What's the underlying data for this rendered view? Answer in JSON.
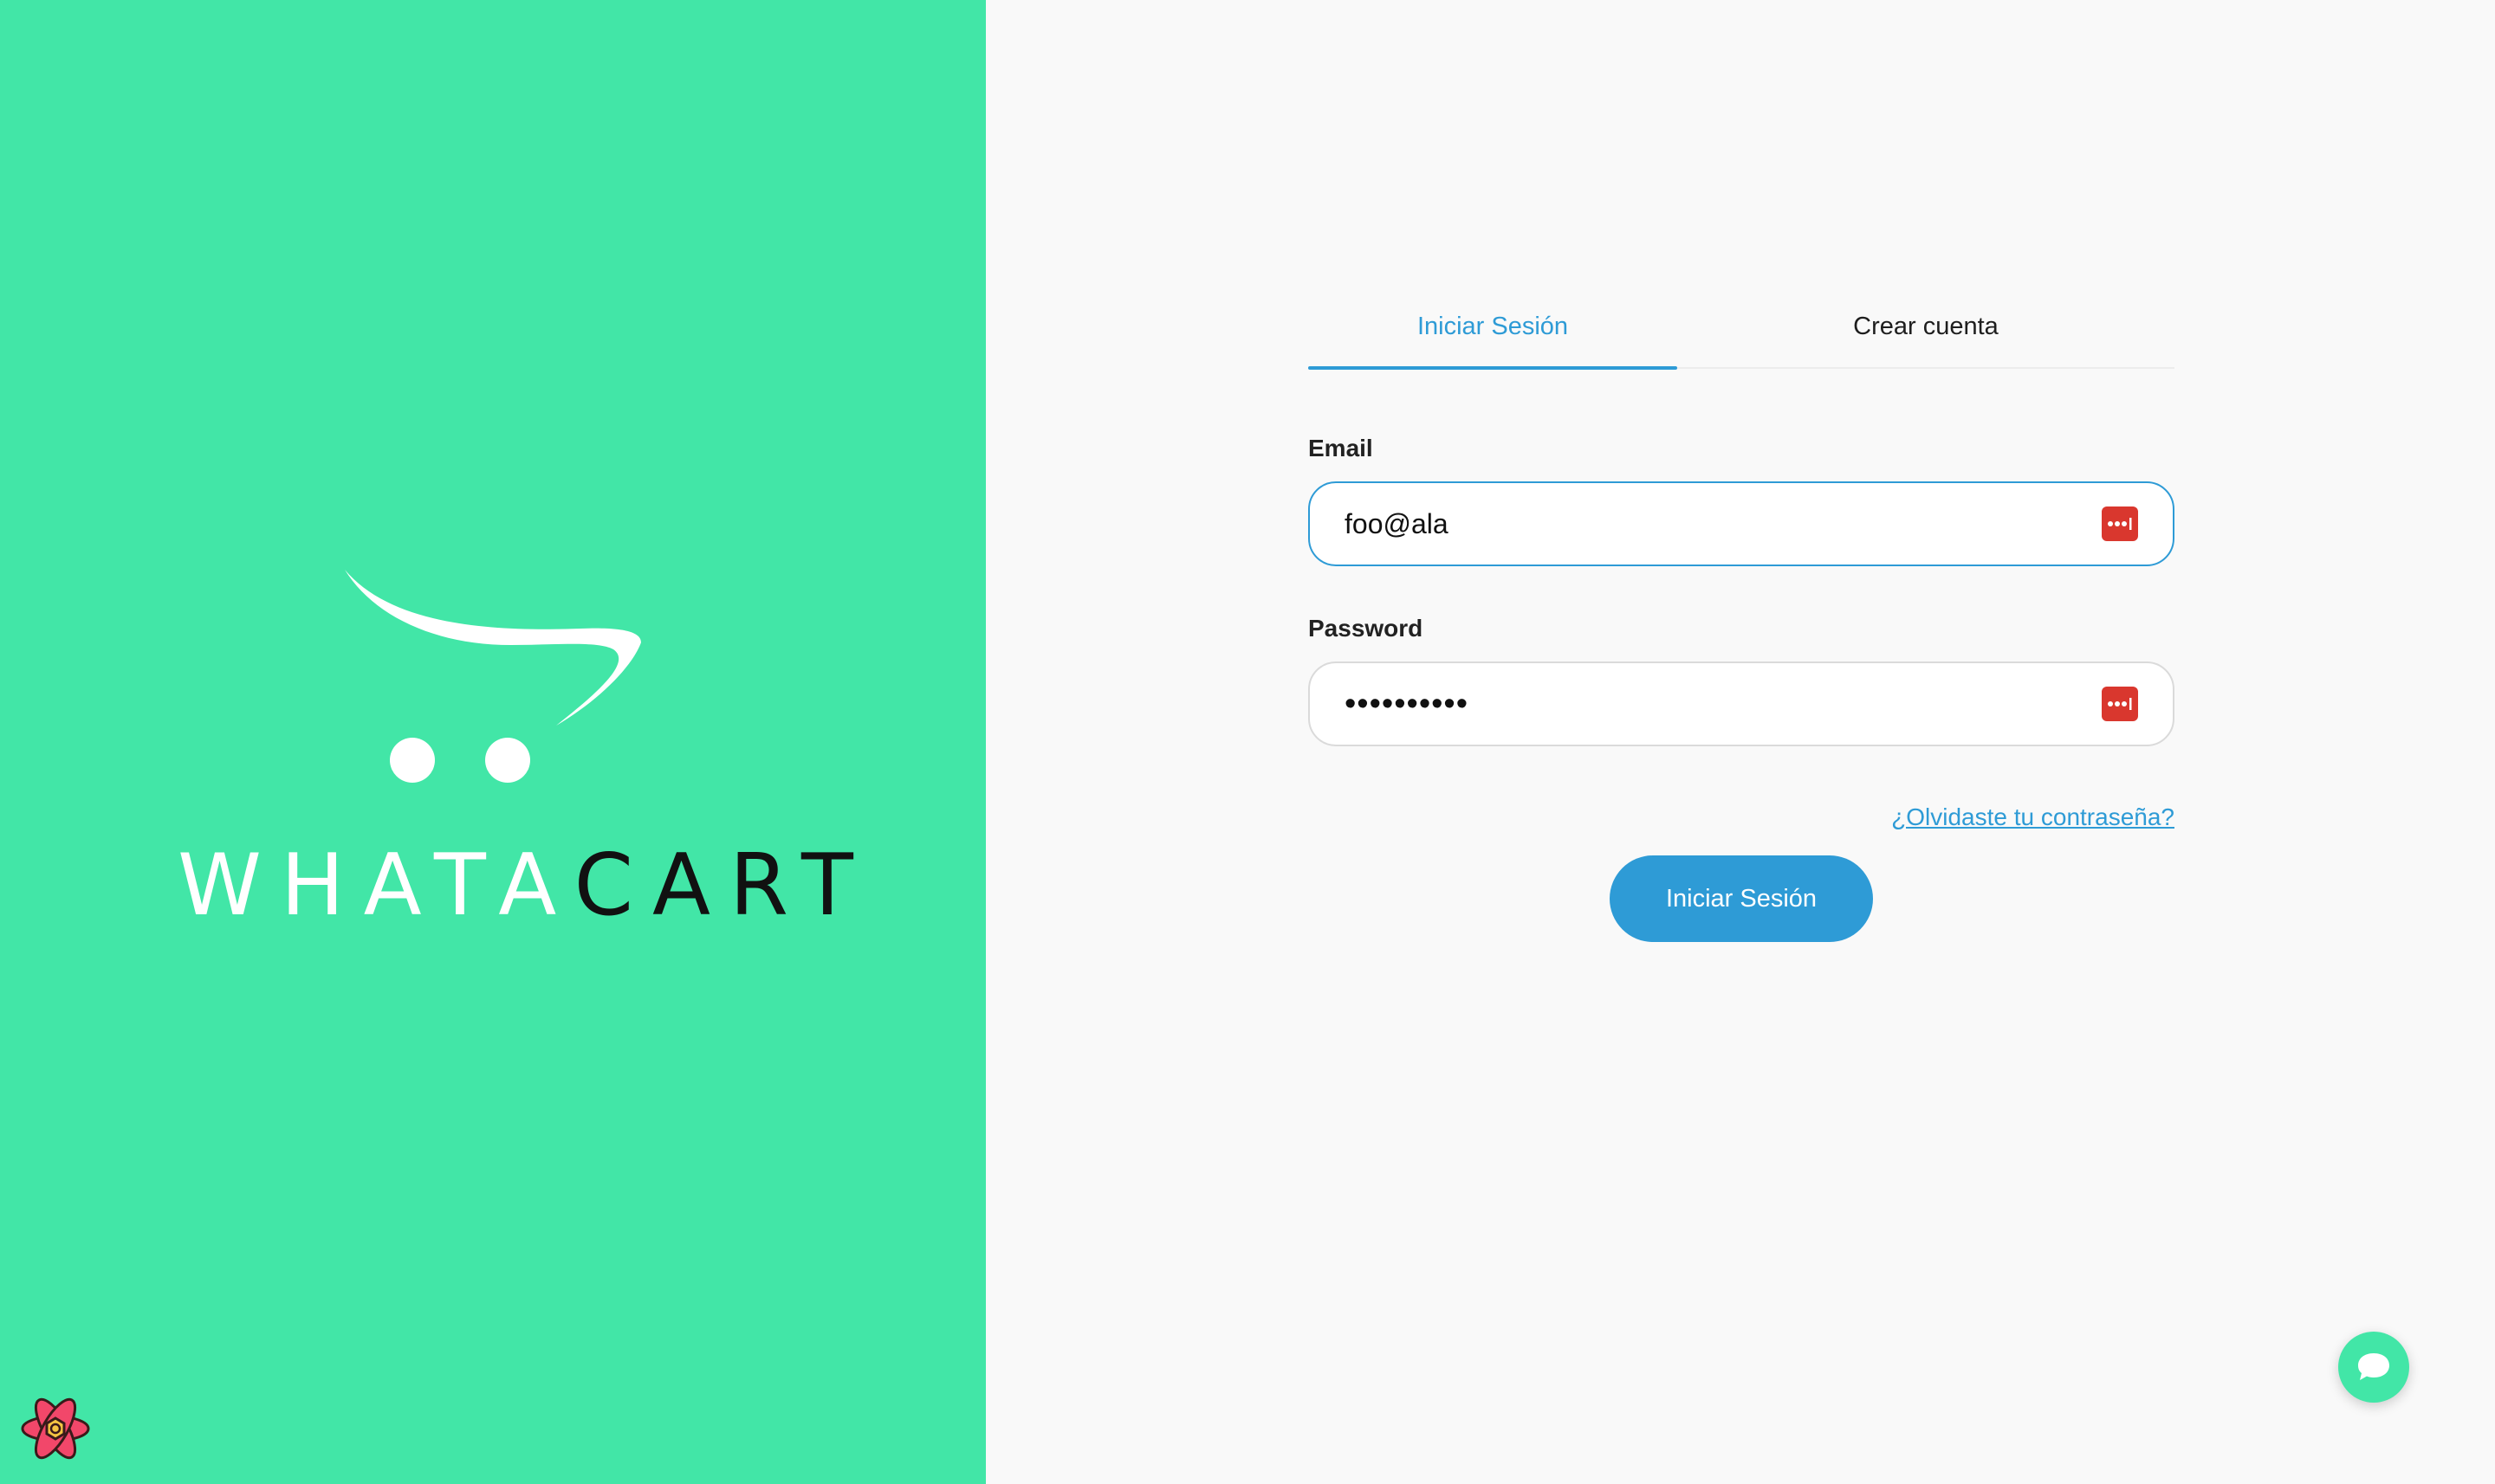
{
  "brand": {
    "wordmark_light": "WHATA",
    "wordmark_dark": "CART",
    "panel_color": "#42e6a7"
  },
  "tabs": {
    "login_label": "Iniciar Sesión",
    "register_label": "Crear cuenta",
    "active": "login"
  },
  "form": {
    "email_label": "Email",
    "email_value": "foo@ala",
    "password_label": "Password",
    "password_value": "••••••••••",
    "forgot_link": "¿Olvidaste tu contraseña?",
    "submit_label": "Iniciar Sesión"
  },
  "icons": {
    "password_manager": "password-manager-icon",
    "chat": "chat-bubble-icon",
    "devtools": "react-devtools-icon"
  },
  "colors": {
    "accent": "#2e9bd6",
    "brand_green": "#42e6a7",
    "password_manager_red": "#d9372e"
  }
}
